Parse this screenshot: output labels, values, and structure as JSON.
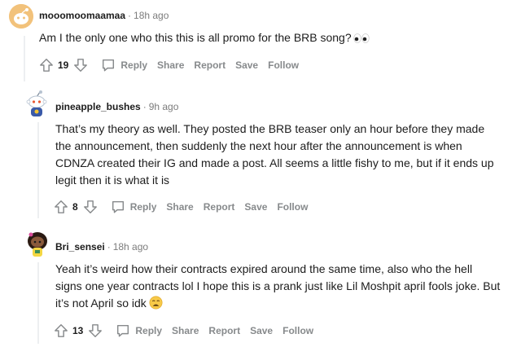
{
  "comments": [
    {
      "username": "mooomoomaamaa",
      "time": "18h ago",
      "text": "Am I the only one who this this is all promo for the BRB song?",
      "emoji": "eyes-emoji",
      "score": "19"
    },
    {
      "username": "pineapple_bushes",
      "time": "9h ago",
      "text": "That’s my theory as well. They posted the BRB teaser only an hour before they made the announcement, then suddenly the next hour after the announcement is when CDNZA created their IG and made a post. All seems a little fishy to me, but if it ends up legit then it is what it is",
      "score": "8"
    },
    {
      "username": "Bri_sensei",
      "time": "18h ago",
      "text": "Yeah it’s weird how their contracts expired around the same time, also who the hell signs one year contracts lol I hope this is a prank just like Lil Moshpit april fools joke. But it’s not April so idk",
      "emoji": "weary-face-emoji",
      "score": "13"
    }
  ],
  "actions": {
    "reply": "Reply",
    "share": "Share",
    "report": "Report",
    "save": "Save",
    "follow": "Follow"
  },
  "colors": {
    "meta_gray": "#7c7c7c",
    "action_gray": "#878a8c",
    "thread_line": "#edeff1",
    "text": "#1c1c1c"
  }
}
